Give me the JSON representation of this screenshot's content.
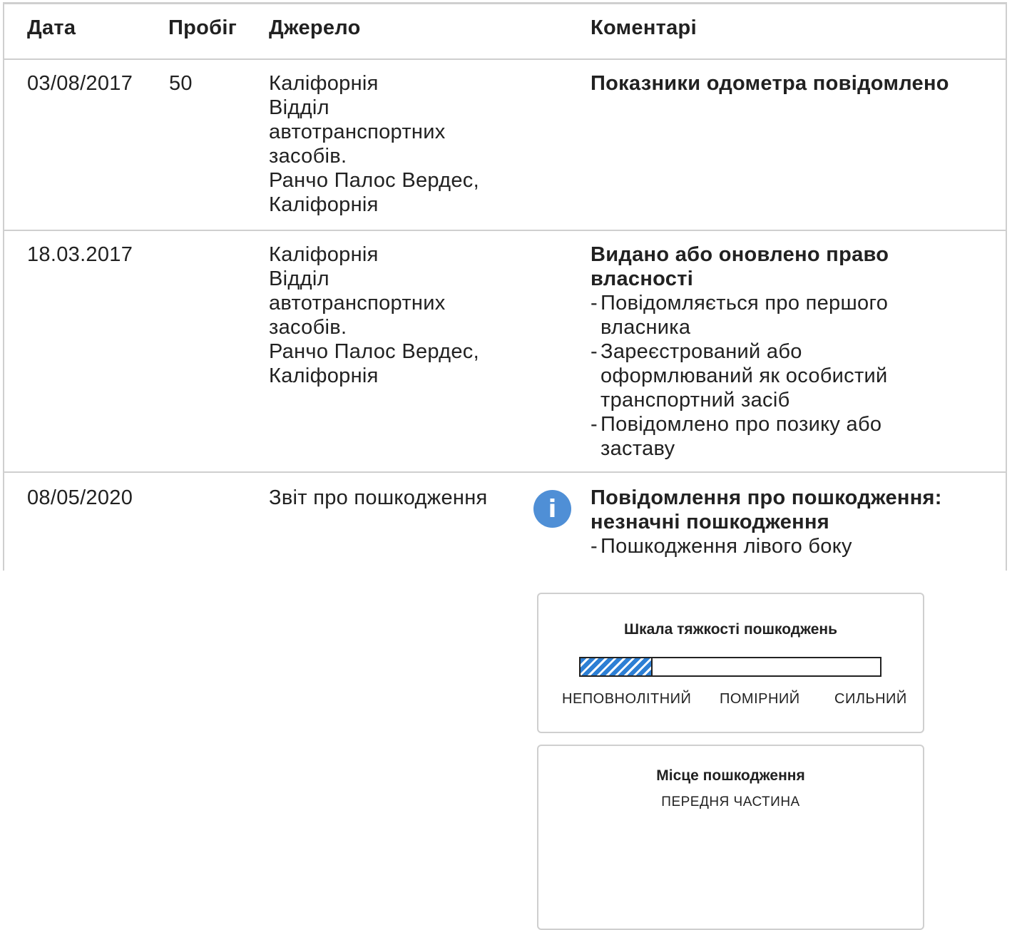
{
  "headers": {
    "date": "Дата",
    "mileage": "Пробіг",
    "source": "Джерело",
    "comments": "Коментарі"
  },
  "rows": [
    {
      "date": "03/08/2017",
      "mileage": "50",
      "source": [
        "Каліфорнія",
        "Відділ",
        "автотранспортних",
        "засобів.",
        "Ранчо Палос Вердес,",
        "Каліфорнія"
      ],
      "comment_title": [
        "Показники одометра повідомлено"
      ],
      "comment_items": []
    },
    {
      "date": "18.03.2017",
      "mileage": "",
      "source": [
        "Каліфорнія",
        "Відділ",
        "автотранспортних",
        "засобів.",
        "Ранчо Палос Вердес,",
        "Каліфорнія"
      ],
      "comment_title": [
        "Видано або оновлено право",
        "власності"
      ],
      "comment_items": [
        [
          "Повідомляється про першого",
          "власника"
        ],
        [
          "Зареєстрований або",
          "оформлюваний як особистий",
          "транспортний засіб"
        ],
        [
          "Повідомлено про позику або",
          "заставу"
        ]
      ]
    },
    {
      "date": "08/05/2020",
      "mileage": "",
      "source": [
        "Звіт про пошкодження"
      ],
      "comment_title": [
        "Повідомлення про пошкодження:",
        "незначні пошкодження"
      ],
      "comment_items": [
        [
          "Пошкодження лівого боку"
        ]
      ]
    }
  ],
  "info_icon": "info-icon",
  "info_icon_glyph": "i",
  "icon_color": "#4f8fd6",
  "severity": {
    "title": "Шкала тяжкості пошкоджень",
    "level_fraction": 0.24,
    "fill_color": "#2d7fd4",
    "labels": [
      "НЕПОВНОЛІТНИЙ",
      "ПОМІРНИЙ",
      "СИЛЬНИЙ"
    ]
  },
  "location": {
    "title": "Місце пошкодження",
    "value": "ПЕРЕДНЯ ЧАСТИНА"
  }
}
